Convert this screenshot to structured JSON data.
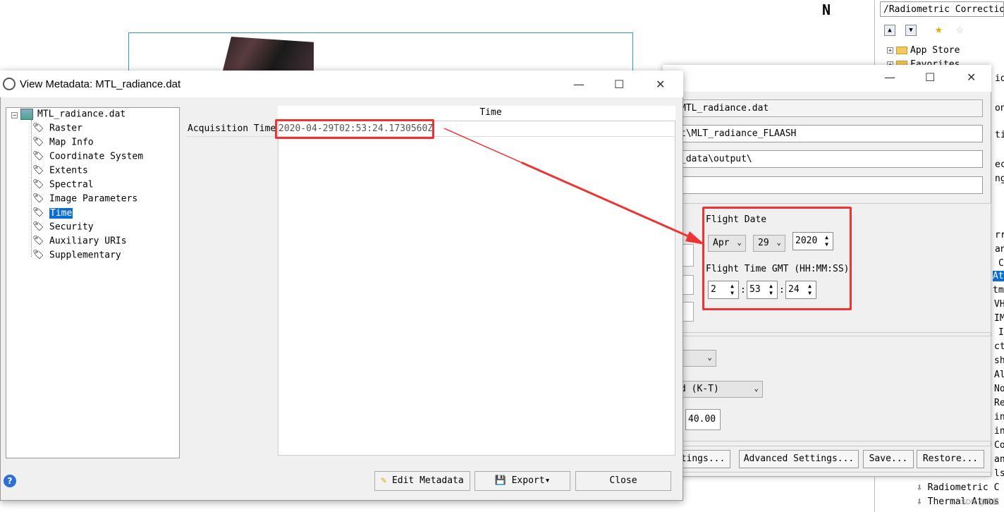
{
  "toolbox": {
    "path": "/Radiometric Correction",
    "items": [
      "App Store",
      "Favorites"
    ],
    "bottom_items": [
      "Radiometric C",
      "Thermal Atmos"
    ],
    "clipped_right": [
      "io",
      "on",
      "ti",
      "ec",
      "ng",
      "rr",
      "an",
      "C",
      "Atm",
      "tmo",
      "VH",
      "IM",
      "I",
      "ct",
      "sh",
      "Al",
      "No",
      "Re",
      "in",
      "in",
      "Co",
      "an",
      "ls"
    ]
  },
  "flaash": {
    "input_radiance": "MTL_radiance.dat",
    "output_reflectance": "t\\MLT_radiance_FLAASH",
    "output_directory": "_data\\output\\",
    "rootname": "",
    "flight_date_label": "Flight Date",
    "month": "Apr",
    "day": "29",
    "year": "2020",
    "flight_time_label": "Flight Time GMT (HH:MM:SS)",
    "hh": "2",
    "mm": "53",
    "ss": "24",
    "aerosol_model": "d (K-T)",
    "visibility": "40.00",
    "buttons": {
      "multispectral": "tings...",
      "advanced": "Advanced Settings...",
      "save": "Save...",
      "restore": "Restore..."
    }
  },
  "meta": {
    "title": "View Metadata: MTL_radiance.dat",
    "root": "MTL_radiance.dat",
    "nodes": [
      "Raster",
      "Map Info",
      "Coordinate System",
      "Extents",
      "Spectral",
      "Image Parameters",
      "Time",
      "Security",
      "Auxiliary URIs",
      "Supplementary"
    ],
    "column_header": "Time",
    "row_label": "Acquisition Time",
    "row_value": "2020-04-29T02:53:24.1730560Z",
    "edit_button": "Edit Metadata",
    "export_button": "Export",
    "close_button": "Close"
  },
  "watermark": "CSDN @清晨"
}
